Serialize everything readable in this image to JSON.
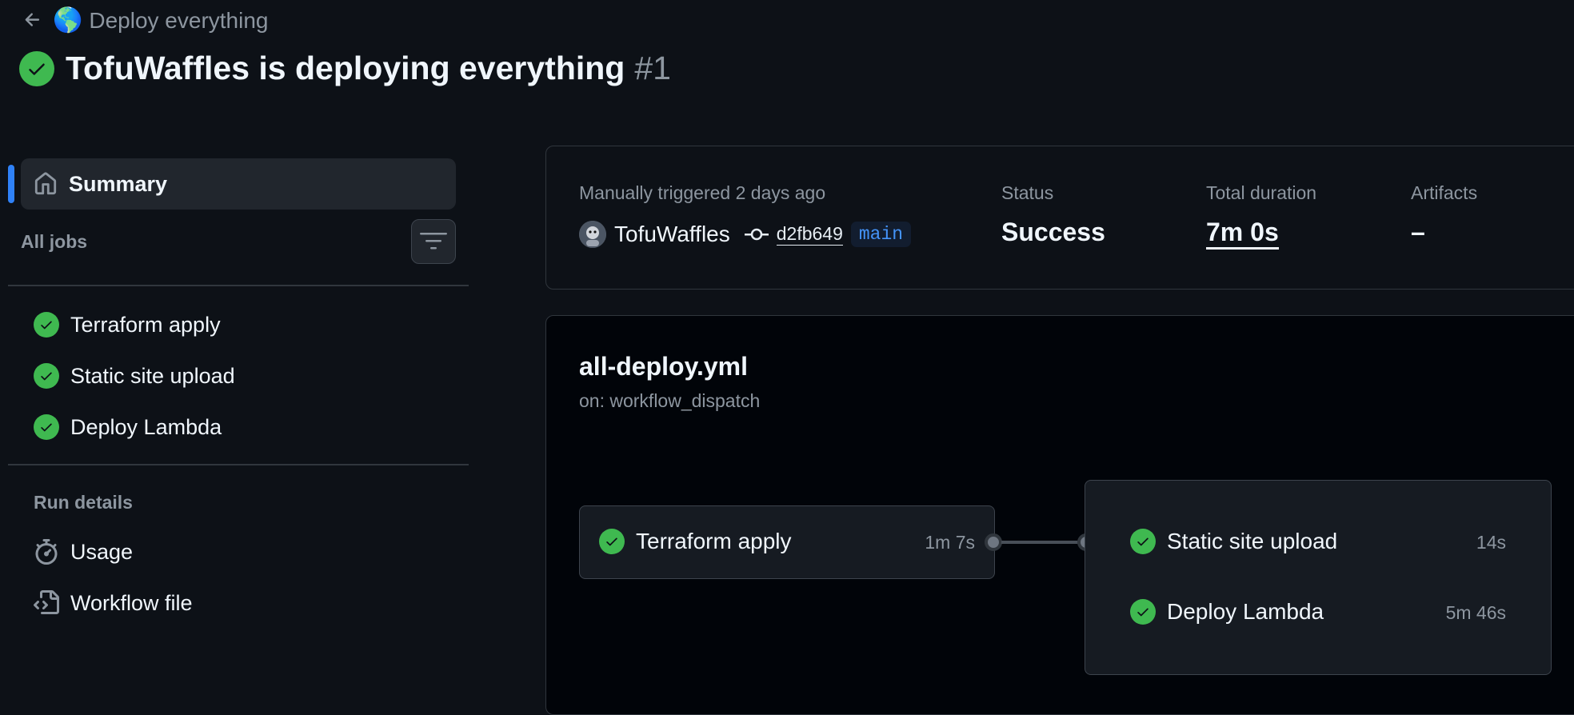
{
  "header": {
    "back_icon": "arrow-left-icon",
    "breadcrumb_emoji": "🌎",
    "breadcrumb": "Deploy everything",
    "title": "TofuWaffles is deploying everything",
    "run_number": "#1"
  },
  "sidebar": {
    "summary_label": "Summary",
    "all_jobs_label": "All jobs",
    "jobs": [
      {
        "label": "Terraform apply",
        "status": "success"
      },
      {
        "label": "Static site upload",
        "status": "success"
      },
      {
        "label": "Deploy Lambda",
        "status": "success"
      }
    ],
    "run_details_label": "Run details",
    "details": [
      {
        "label": "Usage",
        "icon": "stopwatch-icon"
      },
      {
        "label": "Workflow file",
        "icon": "file-code-icon"
      }
    ]
  },
  "summary": {
    "trigger_text": "Manually triggered 2 days ago",
    "actor": "TofuWaffles",
    "commit_sha": "d2fb649",
    "branch": "main",
    "status_label": "Status",
    "status_value": "Success",
    "duration_label": "Total duration",
    "duration_value": "7m 0s",
    "artifacts_label": "Artifacts",
    "artifacts_value": "–"
  },
  "workflow": {
    "file": "all-deploy.yml",
    "trigger": "on: workflow_dispatch",
    "first_job": {
      "label": "Terraform apply",
      "time": "1m 7s"
    },
    "group_jobs": [
      {
        "label": "Static site upload",
        "time": "14s"
      },
      {
        "label": "Deploy Lambda",
        "time": "5m 46s"
      }
    ]
  },
  "colors": {
    "background": "#0d1117",
    "success": "#3fb950",
    "accent": "#2f81f7"
  }
}
